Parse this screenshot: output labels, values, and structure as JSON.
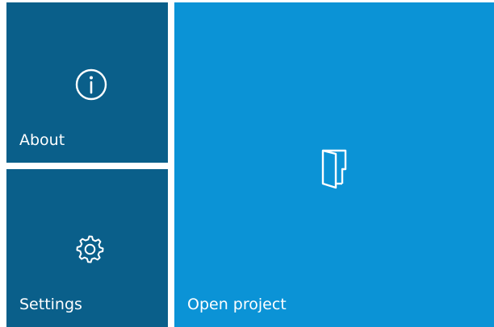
{
  "tiles": {
    "about": {
      "label": "About",
      "icon": "info-icon",
      "color": "#0a5f8a"
    },
    "settings": {
      "label": "Settings",
      "icon": "gear-icon",
      "color": "#0a5f8a"
    },
    "open_project": {
      "label": "Open project",
      "icon": "door-icon",
      "color": "#0b93d6"
    }
  }
}
